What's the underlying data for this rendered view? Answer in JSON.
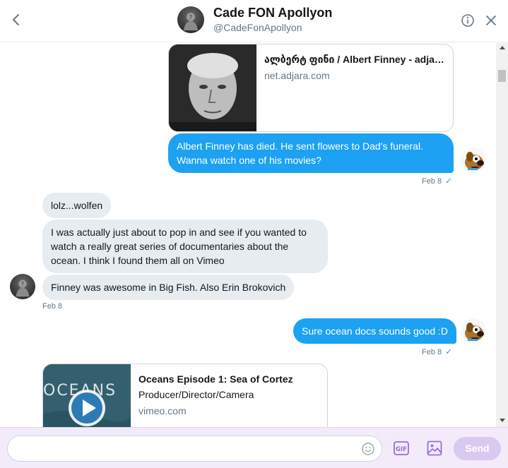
{
  "header": {
    "name": "Cade FON Apollyon",
    "handle": "@CadeFonApollyon"
  },
  "messages": {
    "link_card_1": {
      "title": "ალბერტ ფინი / Albert Finney - adjar...",
      "domain": "net.adjara.com"
    },
    "out_1": {
      "text": "Albert Finney has died. He sent flowers to Dad's funeral. Wanna watch one of his movies?",
      "date": "Feb 8",
      "tick": "✓"
    },
    "in_1": {
      "text": "lolz...wolfen"
    },
    "in_2": {
      "text": "I was actually just about to pop in and see if you wanted to watch a really great series of documentaries about the ocean. I think I found them all on Vimeo"
    },
    "in_3": {
      "text": "Finney was awesome in Big Fish. Also Erin Brokovich",
      "date": "Feb 8"
    },
    "out_2": {
      "text": "Sure ocean docs sounds good :D",
      "date": "Feb 8",
      "tick": "✓"
    },
    "link_card_2": {
      "title": "Oceans Episode 1: Sea of Cortez",
      "desc": "Producer/Director/Camera",
      "domain": "vimeo.com",
      "thumb_text": "OCEANS"
    }
  },
  "composer": {
    "placeholder": "",
    "value": "",
    "send_label": "Send",
    "gif_label": "GIF"
  },
  "icons": {
    "back": "chevron-left-icon",
    "info": "info-icon",
    "close": "close-icon",
    "emoji": "emoji-icon",
    "gif": "gif-icon",
    "image": "image-icon",
    "play": "play-icon"
  },
  "colors": {
    "accent": "#1da1f2",
    "incoming_bubble": "#e6ecf0",
    "composer_bg": "#f3ebfa",
    "send_disabled": "#d9c8f0",
    "icon_purple": "#9a6fd1"
  }
}
